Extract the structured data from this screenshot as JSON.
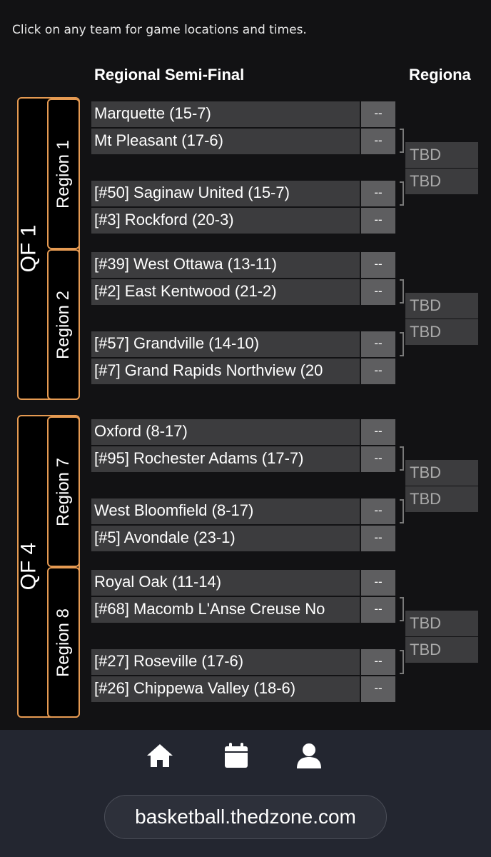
{
  "instruction": "Click on any team for game locations and times.",
  "columns": {
    "semi": "Regional Semi-Final",
    "final": "Regiona"
  },
  "quarterfinals": [
    {
      "label": "QF 1",
      "regions": [
        {
          "label": "Region 1",
          "games": [
            {
              "teams": [
                {
                  "name": "Marquette (15-7)",
                  "score": "--"
                },
                {
                  "name": "Mt Pleasant (17-6)",
                  "score": "--"
                }
              ]
            },
            {
              "teams": [
                {
                  "name": "[#50] Saginaw United (15-7)",
                  "score": "--"
                },
                {
                  "name": "[#3] Rockford (20-3)",
                  "score": "--"
                }
              ]
            }
          ],
          "final": [
            "TBD",
            "TBD"
          ]
        },
        {
          "label": "Region 2",
          "games": [
            {
              "teams": [
                {
                  "name": "[#39] West Ottawa (13-11)",
                  "score": "--"
                },
                {
                  "name": "[#2] East Kentwood (21-2)",
                  "score": "--"
                }
              ]
            },
            {
              "teams": [
                {
                  "name": "[#57] Grandville (14-10)",
                  "score": "--"
                },
                {
                  "name": "[#7] Grand Rapids Northview (20",
                  "score": "--"
                }
              ]
            }
          ],
          "final": [
            "TBD",
            "TBD"
          ]
        }
      ]
    },
    {
      "label": "QF 4",
      "regions": [
        {
          "label": "Region 7",
          "games": [
            {
              "teams": [
                {
                  "name": "Oxford (8-17)",
                  "score": "--"
                },
                {
                  "name": "[#95] Rochester Adams (17-7)",
                  "score": "--"
                }
              ]
            },
            {
              "teams": [
                {
                  "name": "West Bloomfield (8-17)",
                  "score": "--"
                },
                {
                  "name": "[#5] Avondale (23-1)",
                  "score": "--"
                }
              ]
            }
          ],
          "final": [
            "TBD",
            "TBD"
          ]
        },
        {
          "label": "Region 8",
          "games": [
            {
              "teams": [
                {
                  "name": "Royal Oak (11-14)",
                  "score": "--"
                },
                {
                  "name": "[#68] Macomb L'Anse Creuse No",
                  "score": "--"
                }
              ]
            },
            {
              "teams": [
                {
                  "name": "[#27] Roseville (17-6)",
                  "score": "--"
                },
                {
                  "name": "[#26] Chippewa Valley (18-6)",
                  "score": "--"
                }
              ]
            }
          ],
          "final": [
            "TBD",
            "TBD"
          ]
        }
      ]
    }
  ],
  "nav": {
    "icons": [
      "home-icon",
      "calendar-icon",
      "user-icon"
    ]
  },
  "footer": {
    "url": "basketball.thedzone.com"
  },
  "colors": {
    "accent": "#e59a52",
    "background": "#121214",
    "team_cell": "#3c3c3e",
    "score_cell": "#5e5e60",
    "footer": "#232630"
  }
}
